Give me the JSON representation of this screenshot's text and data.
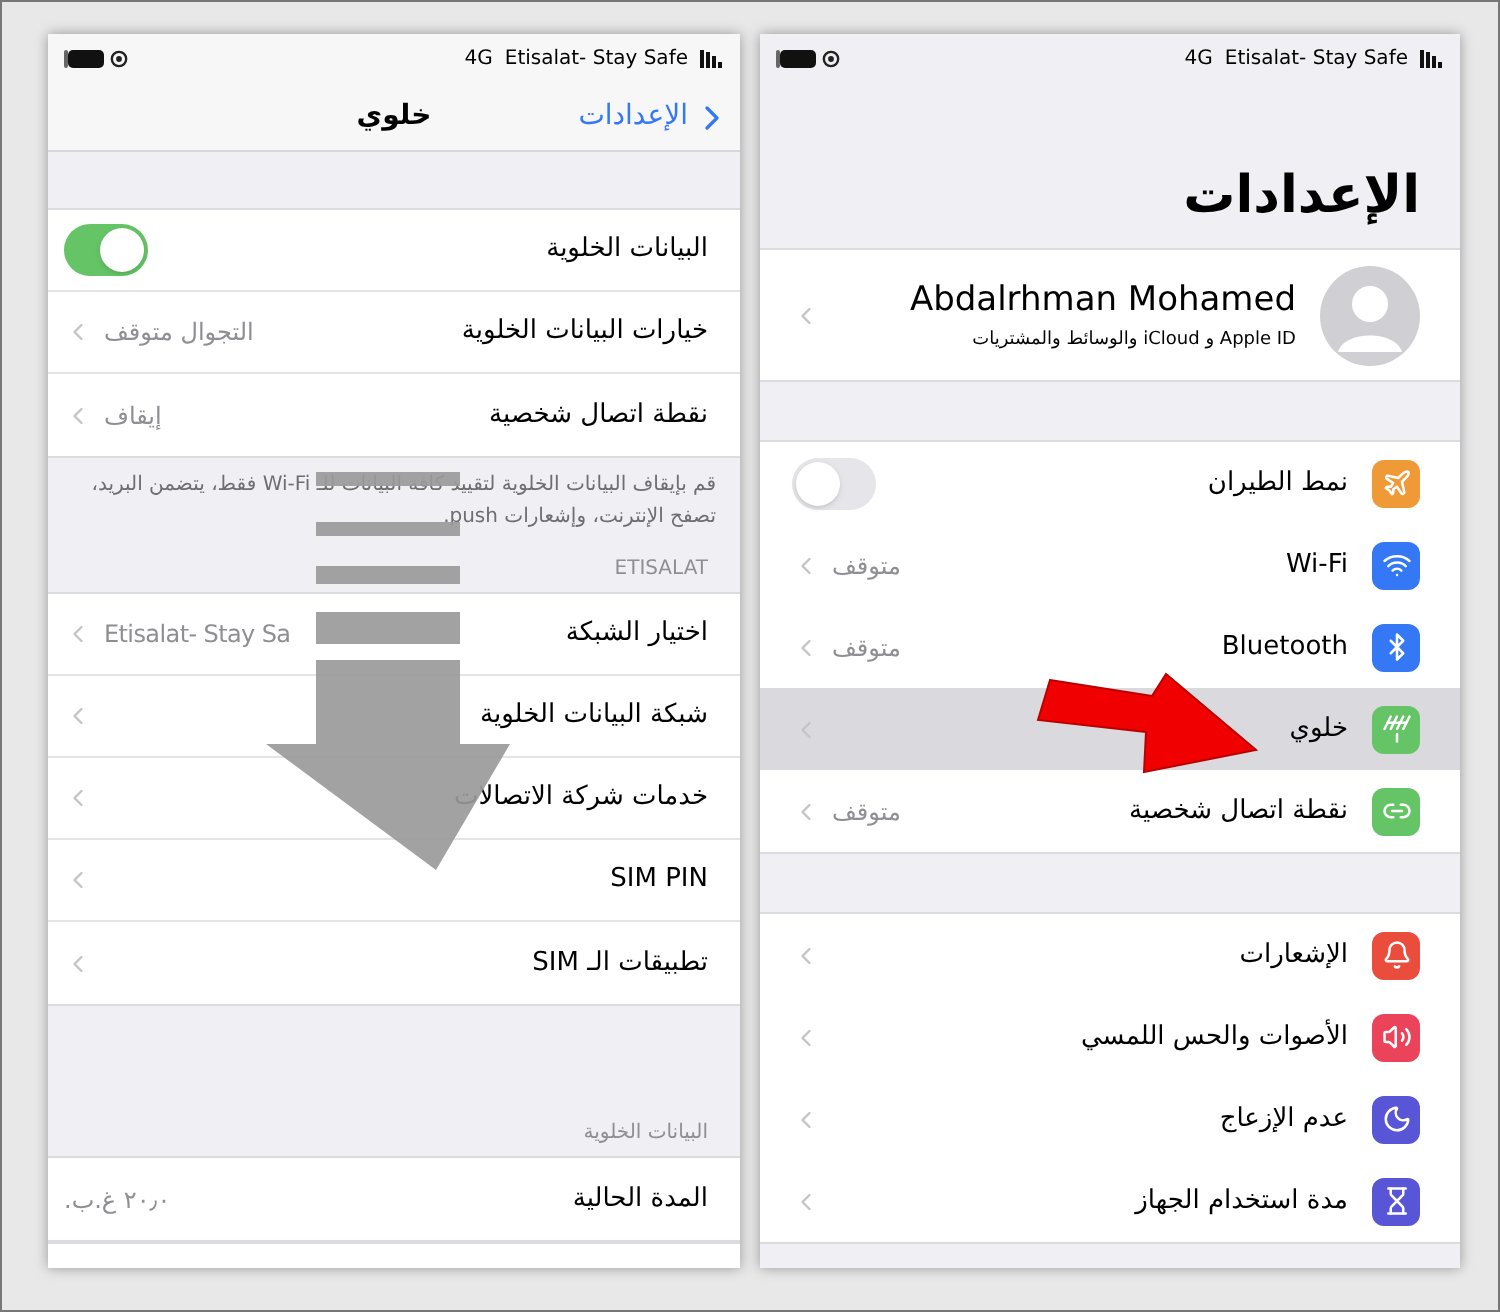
{
  "cellular_screen": {
    "status_bar": {
      "network": "4G",
      "carrier": "Etisalat- Stay Safe"
    },
    "nav": {
      "back": "الإعدادات",
      "title": "خلوي"
    },
    "groups": [
      {
        "rows": [
          {
            "kind": "toggle",
            "label": "البيانات الخلوية",
            "on": true
          },
          {
            "kind": "link",
            "label": "خيارات البيانات الخلوية",
            "value": "التجوال متوقف"
          },
          {
            "kind": "link",
            "label": "نقطة اتصال شخصية",
            "value": "إيقاف"
          }
        ],
        "footer": "قم بإيقاف البيانات الخلوية لتقييد كافة البيانات للـ Wi-Fi فقط، يتضمن البريد، تصفح الإنترنت، وإشعارات push."
      },
      {
        "header": "ETISALAT",
        "rows": [
          {
            "kind": "link",
            "label": "اختيار الشبكة",
            "value": "Etisalat- Stay Sa"
          },
          {
            "kind": "link",
            "label": "شبكة البيانات الخلوية"
          },
          {
            "kind": "link",
            "label": "خدمات شركة الاتصالات"
          },
          {
            "kind": "link",
            "label": "SIM PIN"
          },
          {
            "kind": "link",
            "label": "تطبيقات الـ SIM"
          }
        ]
      },
      {
        "header": "البيانات الخلوية",
        "rows": [
          {
            "kind": "value",
            "label": "المدة الحالية",
            "value": "٢٠٫٠ غ.ب."
          }
        ]
      }
    ]
  },
  "settings_screen": {
    "status_bar": {
      "network": "4G",
      "carrier": "Etisalat- Stay Safe"
    },
    "title": "الإعدادات",
    "profile": {
      "name": "Abdalrhman Mohamed",
      "subtitle": "Apple ID و iCloud والوسائط والمشتريات"
    },
    "sections": [
      {
        "rows": [
          {
            "kind": "toggle",
            "label": "نمط الطيران",
            "on": false,
            "selected": false,
            "color": "#f09a37"
          },
          {
            "kind": "link",
            "label": "Wi-Fi",
            "value": "متوقف",
            "selected": false,
            "color": "#3478f6"
          },
          {
            "kind": "link",
            "label": "Bluetooth",
            "value": "متوقف",
            "selected": false,
            "color": "#3478f6"
          },
          {
            "kind": "link",
            "label": "خلوي",
            "selected": true,
            "color": "#65c466"
          },
          {
            "kind": "link",
            "label": "نقطة اتصال شخصية",
            "value": "متوقف",
            "selected": false,
            "color": "#65c466"
          }
        ]
      },
      {
        "rows": [
          {
            "kind": "link",
            "label": "الإشعارات",
            "selected": false,
            "color": "#eb4d3d"
          },
          {
            "kind": "link",
            "label": "الأصوات والحس اللمسي",
            "selected": false,
            "color": "#eb445a"
          },
          {
            "kind": "link",
            "label": "عدم الإزعاج",
            "selected": false,
            "color": "#5856d6"
          },
          {
            "kind": "link",
            "label": "مدة استخدام الجهاز",
            "selected": false,
            "color": "#5856d6"
          }
        ]
      }
    ]
  }
}
